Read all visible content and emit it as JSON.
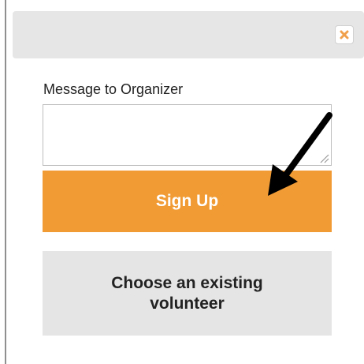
{
  "dialog": {
    "close_icon": "close-x-icon",
    "message_label": "Message to Organizer",
    "message_value": "",
    "signup_label": "Sign Up",
    "choose_label": "Choose an existing volunteer"
  },
  "colors": {
    "signup_bg": "#f19b34",
    "choose_bg": "#e5e5e5",
    "header_bg": "#e6e6e6",
    "close_x": "#f0a04b"
  },
  "annotation": {
    "arrow_icon": "pointer-arrow-icon"
  }
}
